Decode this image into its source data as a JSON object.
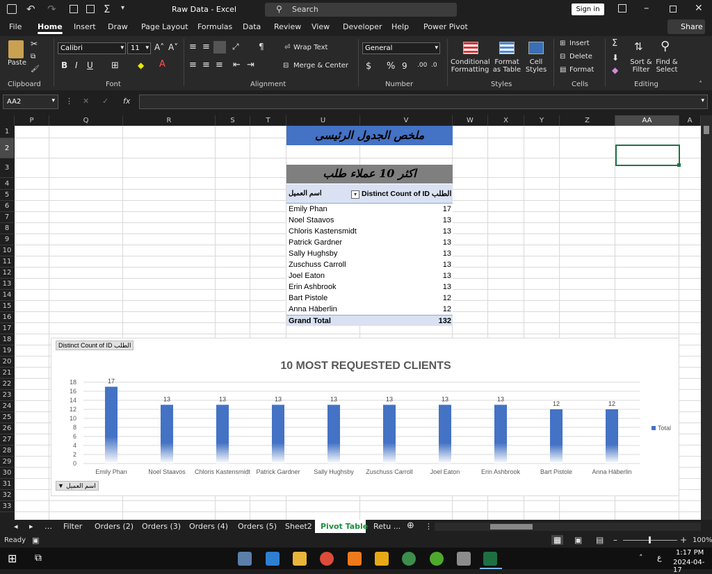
{
  "titlebar": {
    "title": "Raw Data  -  Excel",
    "search_placeholder": "Search",
    "signin": "Sign in"
  },
  "menu": [
    "File",
    "Home",
    "Insert",
    "Draw",
    "Page Layout",
    "Formulas",
    "Data",
    "Review",
    "View",
    "Developer",
    "Help",
    "Power Pivot"
  ],
  "share_label": "Share",
  "ribbon": {
    "paste": "Paste",
    "font_name": "Calibri",
    "font_size": "11",
    "wrap_text": "Wrap Text",
    "merge_center": "Merge & Center",
    "number_format": "General",
    "conditional_formatting": "Conditional Formatting",
    "format_as_table": "Format as Table",
    "cell_styles": "Cell Styles",
    "insert": "Insert",
    "delete": "Delete",
    "format": "Format",
    "sort_filter": "Sort & Filter",
    "find_select": "Find & Select",
    "groups": {
      "clipboard": "Clipboard",
      "font": "Font",
      "alignment": "Alignment",
      "number": "Number",
      "styles": "Styles",
      "cells": "Cells",
      "editing": "Editing"
    }
  },
  "formula": {
    "name_box": "AA2",
    "value": ""
  },
  "columns": [
    "P",
    "Q",
    "R",
    "S",
    "T",
    "U",
    "V",
    "W",
    "X",
    "Y",
    "Z",
    "AA",
    "A"
  ],
  "rows": [
    "1",
    "2",
    "3",
    "4",
    "5",
    "6",
    "7",
    "8",
    "9",
    "10",
    "11",
    "12",
    "13",
    "14",
    "15",
    "16",
    "17",
    "18",
    "19",
    "20",
    "21",
    "22",
    "23",
    "24",
    "25",
    "26",
    "27",
    "28",
    "29",
    "30",
    "31",
    "32",
    "33"
  ],
  "pivot": {
    "title1": "ملخص الجدول الرئيسى",
    "title2": "اكثر 10 عملاء طلب",
    "header_left": "اسم العميل",
    "header_right": "Distinct Count of ID الطلب",
    "rows": [
      {
        "name": "Emily Phan",
        "value": "17"
      },
      {
        "name": "Noel Staavos",
        "value": "13"
      },
      {
        "name": "Chloris Kastensmidt",
        "value": "13"
      },
      {
        "name": "Patrick Gardner",
        "value": "13"
      },
      {
        "name": "Sally Hughsby",
        "value": "13"
      },
      {
        "name": "Zuschuss Carroll",
        "value": "13"
      },
      {
        "name": "Joel Eaton",
        "value": "13"
      },
      {
        "name": "Erin Ashbrook",
        "value": "13"
      },
      {
        "name": "Bart Pistole",
        "value": "12"
      },
      {
        "name": "Anna Häberlin",
        "value": "12"
      }
    ],
    "grand_total_label": "Grand Total",
    "grand_total_value": "132"
  },
  "chart_field_button": "Distinct Count of ID الطلب",
  "chart_axis_field_button": "اسم العميل",
  "chart_data": {
    "type": "bar",
    "title": "10 MOST REQUESTED CLIENTS",
    "categories": [
      "Emily Phan",
      "Noel Staavos",
      "Chloris Kastensmidt",
      "Patrick Gardner",
      "Sally Hughsby",
      "Zuschuss Carroll",
      "Joel Eaton",
      "Erin Ashbrook",
      "Bart Pistole",
      "Anna Häberlin"
    ],
    "series": [
      {
        "name": "Total",
        "values": [
          17,
          13,
          13,
          13,
          13,
          13,
          13,
          13,
          12,
          12
        ]
      }
    ],
    "ylim": [
      0,
      18
    ],
    "yticks": [
      "0",
      "2",
      "4",
      "6",
      "8",
      "10",
      "12",
      "14",
      "16",
      "18"
    ],
    "legend": "right",
    "grid": true,
    "bar_color": "#4472c4"
  },
  "sheets": [
    "Filter",
    "Orders (2)",
    "Orders (3)",
    "Orders (4)",
    "Orders (5)",
    "Sheet2",
    "Pivot Table",
    "Retu ..."
  ],
  "active_sheet": "Pivot Table",
  "status": {
    "ready": "Ready",
    "zoom": "100%"
  },
  "taskbar": {
    "time": "1:17 PM",
    "date": "2024-04-17",
    "lang": "ع"
  }
}
